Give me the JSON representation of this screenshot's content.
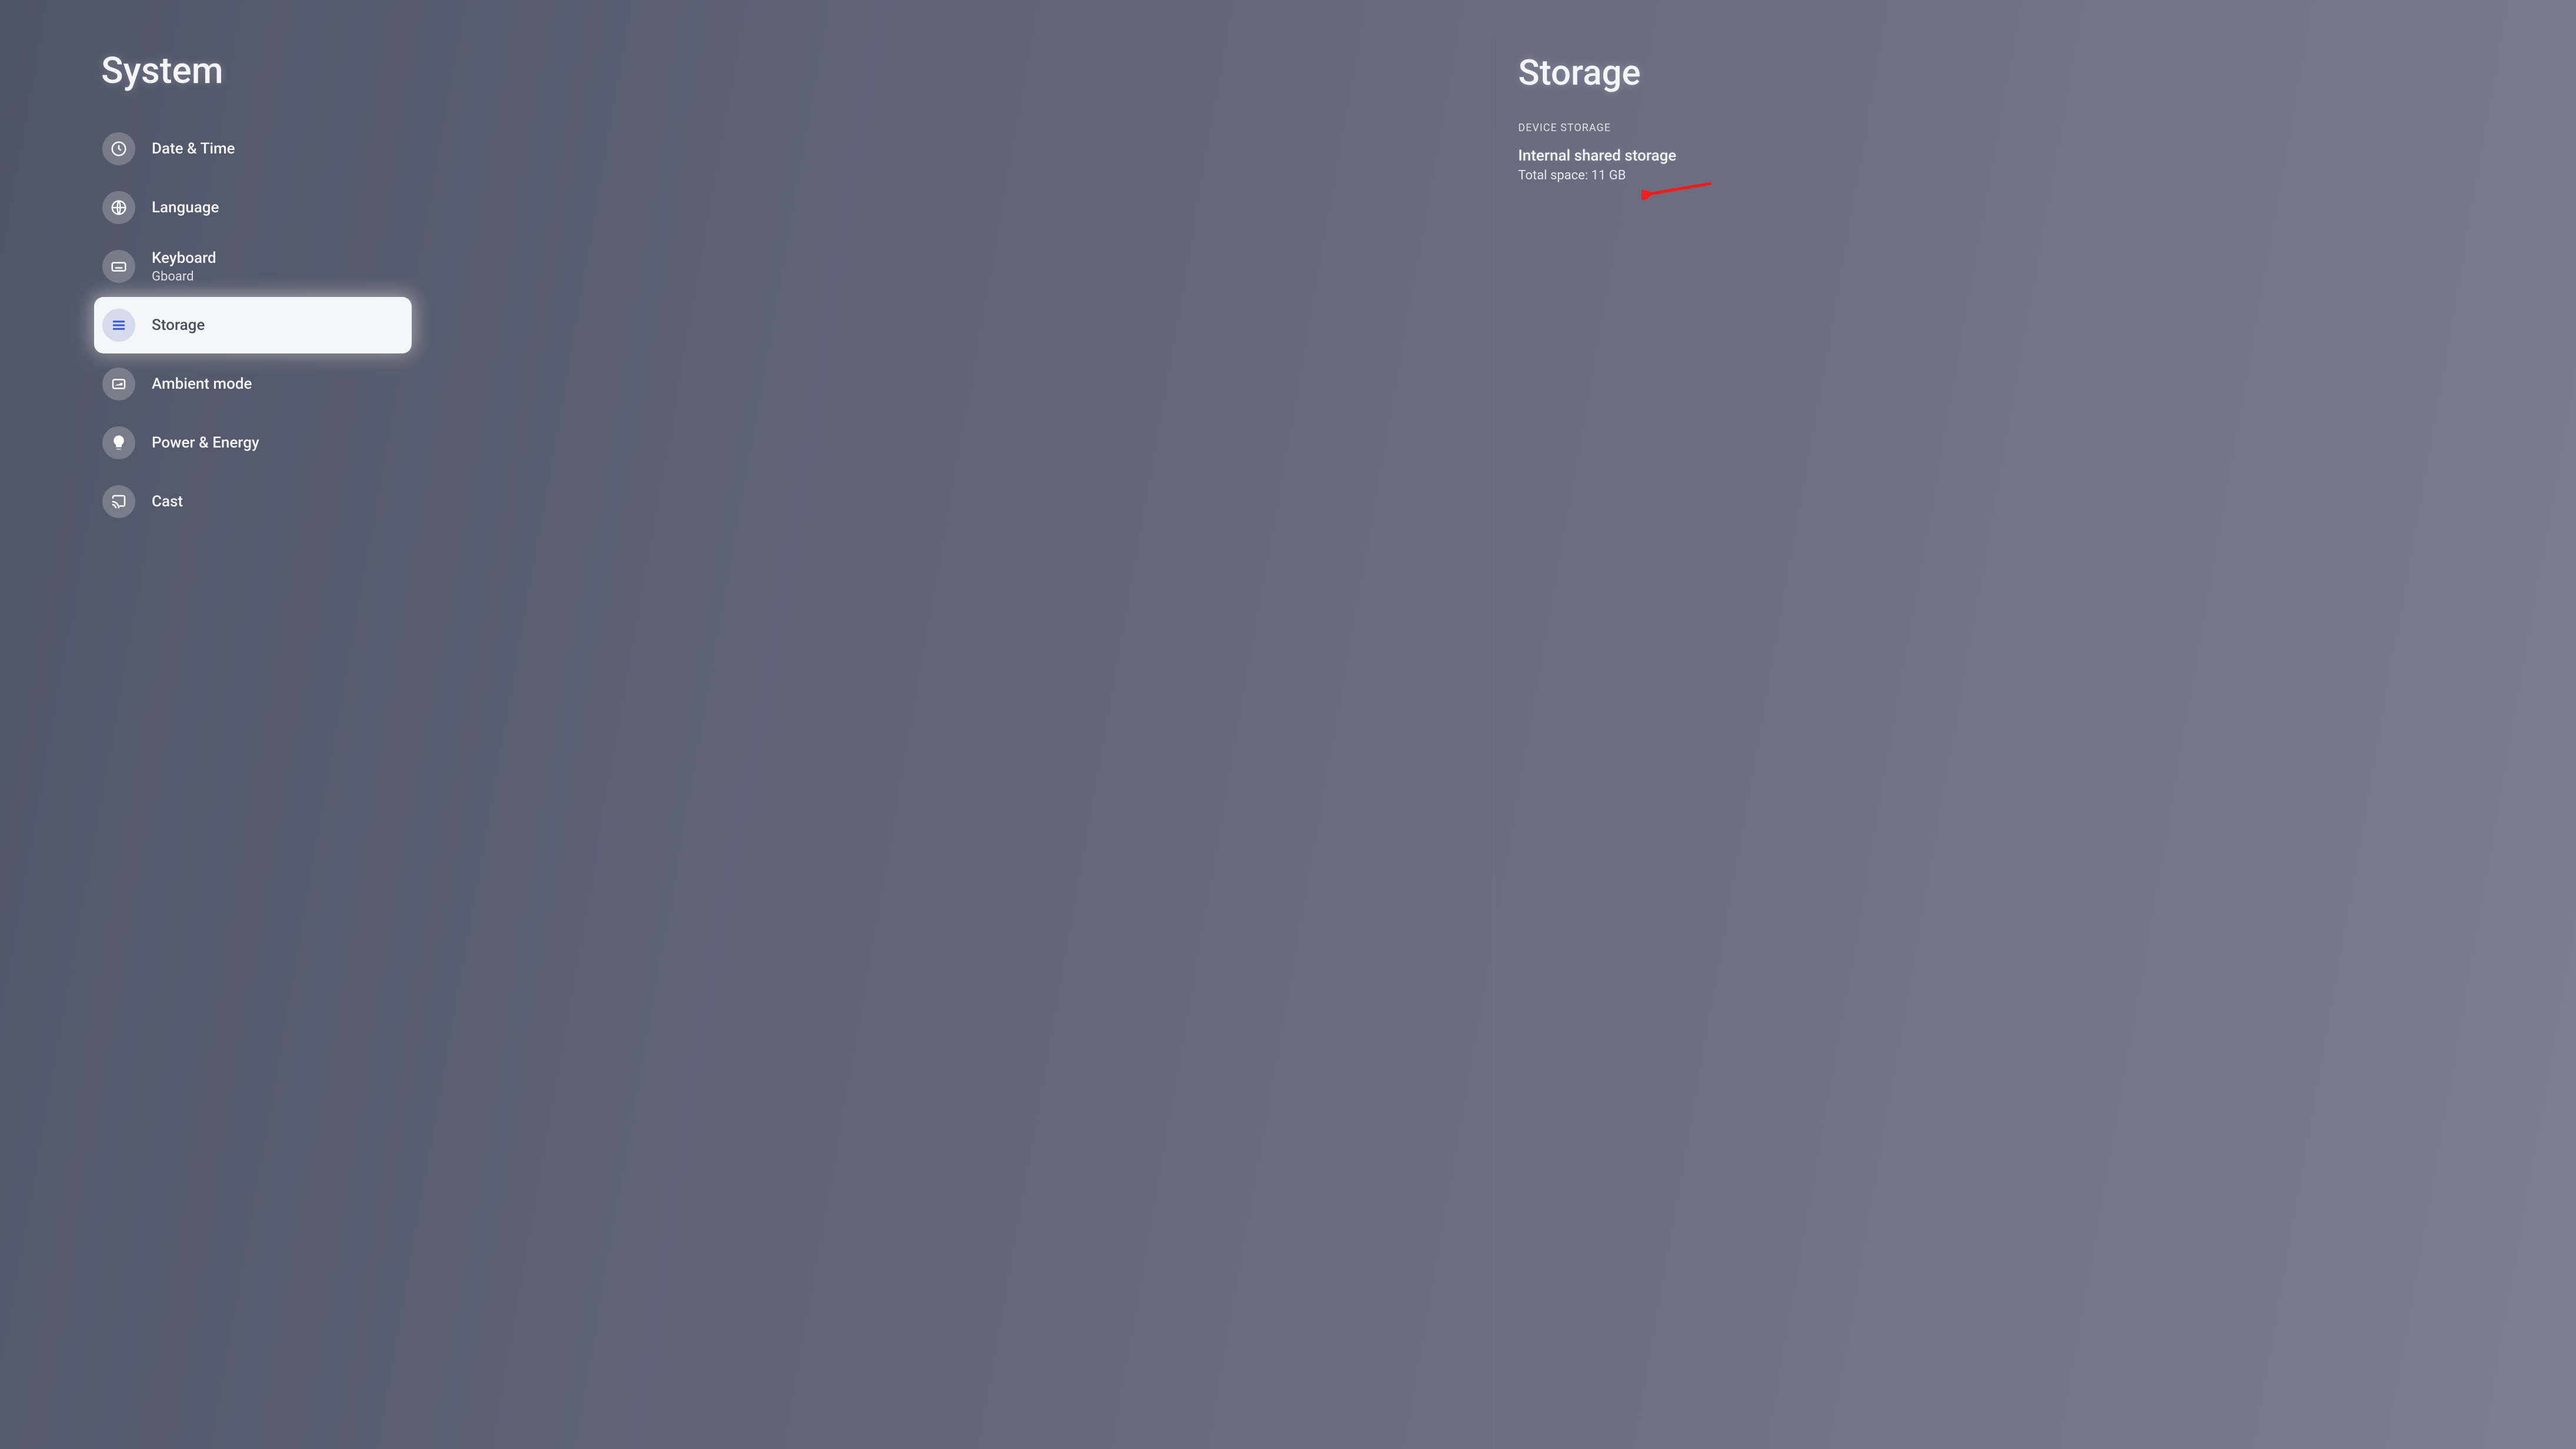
{
  "left": {
    "title": "System",
    "items": [
      {
        "icon": "clock-icon",
        "label": "Date & Time",
        "sublabel": null,
        "selected": false
      },
      {
        "icon": "globe-icon",
        "label": "Language",
        "sublabel": null,
        "selected": false
      },
      {
        "icon": "keyboard-icon",
        "label": "Keyboard",
        "sublabel": "Gboard",
        "selected": false
      },
      {
        "icon": "storage-icon",
        "label": "Storage",
        "sublabel": null,
        "selected": true
      },
      {
        "icon": "ambient-icon",
        "label": "Ambient mode",
        "sublabel": null,
        "selected": false
      },
      {
        "icon": "power-icon",
        "label": "Power & Energy",
        "sublabel": null,
        "selected": false
      },
      {
        "icon": "cast-icon",
        "label": "Cast",
        "sublabel": null,
        "selected": false
      }
    ]
  },
  "right": {
    "title": "Storage",
    "section_header": "DEVICE STORAGE",
    "internal": {
      "title": "Internal shared storage",
      "subtitle": "Total space: 11 GB"
    }
  }
}
